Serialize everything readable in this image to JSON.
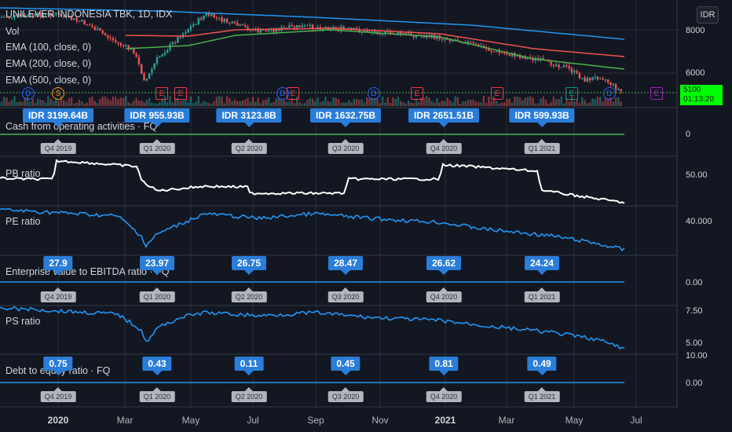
{
  "header": {
    "title": "UNILEVER INDONESIA TBK, 1D, IDX",
    "vol": "Vol",
    "ema100": "EMA (100, close, 0)",
    "ema200": "EMA (200, close, 0)",
    "ema500": "EMA (500, close, 0)"
  },
  "currency_button": "IDR",
  "last_price": {
    "price": "5100",
    "countdown": "01:13:20"
  },
  "price_scale": {
    "main": [
      "8000",
      "6000"
    ],
    "cfo": [
      "0"
    ],
    "pb": [
      "50.00"
    ],
    "pe": [
      "40.000"
    ],
    "ev": [
      "0.00"
    ],
    "ps": [
      "7.50",
      "5.00"
    ],
    "de": [
      "10.00",
      "0.00"
    ]
  },
  "panes": {
    "cfo": "Cash from operating activities · FQ",
    "pb": "PB ratio",
    "pe": "PE ratio",
    "ev": "Enterprise value to EBITDA ratio · FQ",
    "ps": "PS ratio",
    "de": "Debt to equity ratio · FQ"
  },
  "quarters": [
    "Q4 2019",
    "Q1 2020",
    "Q2 2020",
    "Q3 2020",
    "Q4 2020",
    "Q1 2021"
  ],
  "cfo_values": [
    "IDR 3199.64B",
    "IDR 955.93B",
    "IDR 3123.8B",
    "IDR 1632.75B",
    "IDR 2651.51B",
    "IDR 599.93B"
  ],
  "ev_values": [
    "27.9",
    "23.97",
    "26.75",
    "28.47",
    "26.62",
    "24.24"
  ],
  "de_values": [
    "0.75",
    "0.43",
    "0.11",
    "0.45",
    "0.81",
    "0.49"
  ],
  "events": [
    {
      "t": "D",
      "c": "#2962ff"
    },
    {
      "t": "S",
      "c": "#ff9800"
    },
    {
      "t": "E",
      "c": "#f23645"
    },
    {
      "t": "E",
      "c": "#f23645"
    },
    {
      "t": "D",
      "c": "#2962ff"
    },
    {
      "t": "E",
      "c": "#f23645"
    },
    {
      "t": "D",
      "c": "#2962ff"
    },
    {
      "t": "E",
      "c": "#f23645"
    },
    {
      "t": "E",
      "c": "#f23645"
    },
    {
      "t": "E",
      "c": "#089981"
    },
    {
      "t": "D",
      "c": "#2962ff"
    },
    {
      "t": "E",
      "c": "#9c27b0"
    }
  ],
  "time_axis": [
    "2020",
    "Mar",
    "May",
    "Jul",
    "Sep",
    "Nov",
    "2021",
    "Mar",
    "May",
    "Jul"
  ],
  "colors": {
    "bg": "#131722",
    "grid": "#2a2e39",
    "candle_up": "#26a69a",
    "candle_down": "#ef5350",
    "ema100": "#ef5350",
    "ema200": "#4caf50",
    "ema500": "#2196f3",
    "ratio_line": "#2196f3",
    "pb_line": "#ffffff",
    "zero_line": "#4caf50",
    "badge": "#2a7dd8"
  },
  "chart_data": {
    "type": "line",
    "title": "UNILEVER INDONESIA TBK, 1D, IDX",
    "series": [
      {
        "name": "EMA (500, close, 0)",
        "values": [
          8650,
          8500,
          8300,
          8000,
          7600
        ]
      },
      {
        "name": "EMA (200, close, 0)",
        "values": [
          8100,
          7850,
          8200,
          8000,
          6700
        ]
      },
      {
        "name": "EMA (100, close, 0)",
        "values": [
          8200,
          7950,
          8250,
          7900,
          6300
        ]
      }
    ],
    "x": [
      "2020",
      "May",
      "Sep",
      "2021",
      "May"
    ]
  }
}
